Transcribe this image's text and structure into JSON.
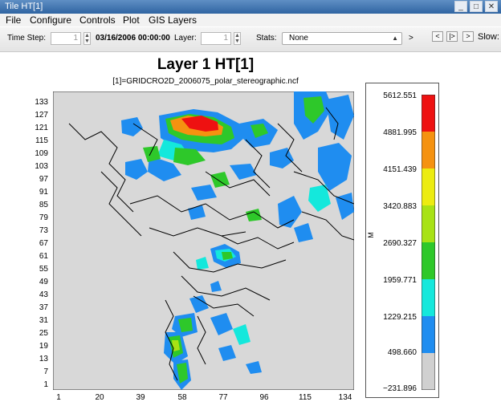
{
  "window": {
    "title": "Tile HT[1]",
    "controls": [
      "_",
      "□",
      "✕"
    ]
  },
  "menu": [
    "File",
    "Configure",
    "Controls",
    "Plot",
    "GIS Layers"
  ],
  "toolbar": {
    "time_step_label": "Time Step:",
    "time_step_value": "1",
    "datetime": "03/16/2006 00:00:00",
    "layer_label": "Layer:",
    "layer_value": "1",
    "stats_label": "Stats:",
    "stats_value": "None",
    "stats_next": ">",
    "nav_buttons": [
      "<",
      "|>",
      ">"
    ],
    "slow_label": "Slow:"
  },
  "plot": {
    "title": "Layer 1 HT[1]",
    "subtitle": "[1]=GRIDCRO2D_2006075_polar_stereographic.ncf",
    "y_ticks": [
      "133",
      "127",
      "121",
      "115",
      "109",
      "103",
      "97",
      "91",
      "85",
      "79",
      "73",
      "67",
      "61",
      "55",
      "49",
      "43",
      "37",
      "31",
      "25",
      "19",
      "13",
      "7",
      "1"
    ],
    "x_ticks": [
      "1",
      "20",
      "39",
      "58",
      "77",
      "96",
      "115",
      "134"
    ]
  },
  "legend": {
    "unit": "M",
    "ticks": [
      "5612.551",
      "4881.995",
      "4151.439",
      "3420.883",
      "2690.327",
      "1959.771",
      "1229.215",
      "498.660",
      "−231.896"
    ],
    "colors": [
      "#ee1111",
      "#f59210",
      "#ecec10",
      "#a8e214",
      "#2ec82a",
      "#14e8dc",
      "#1f8df0",
      "#d0d0d0"
    ]
  },
  "colors": {
    "background": "#d8d8d8",
    "titlebar": "#3b6ea9"
  }
}
